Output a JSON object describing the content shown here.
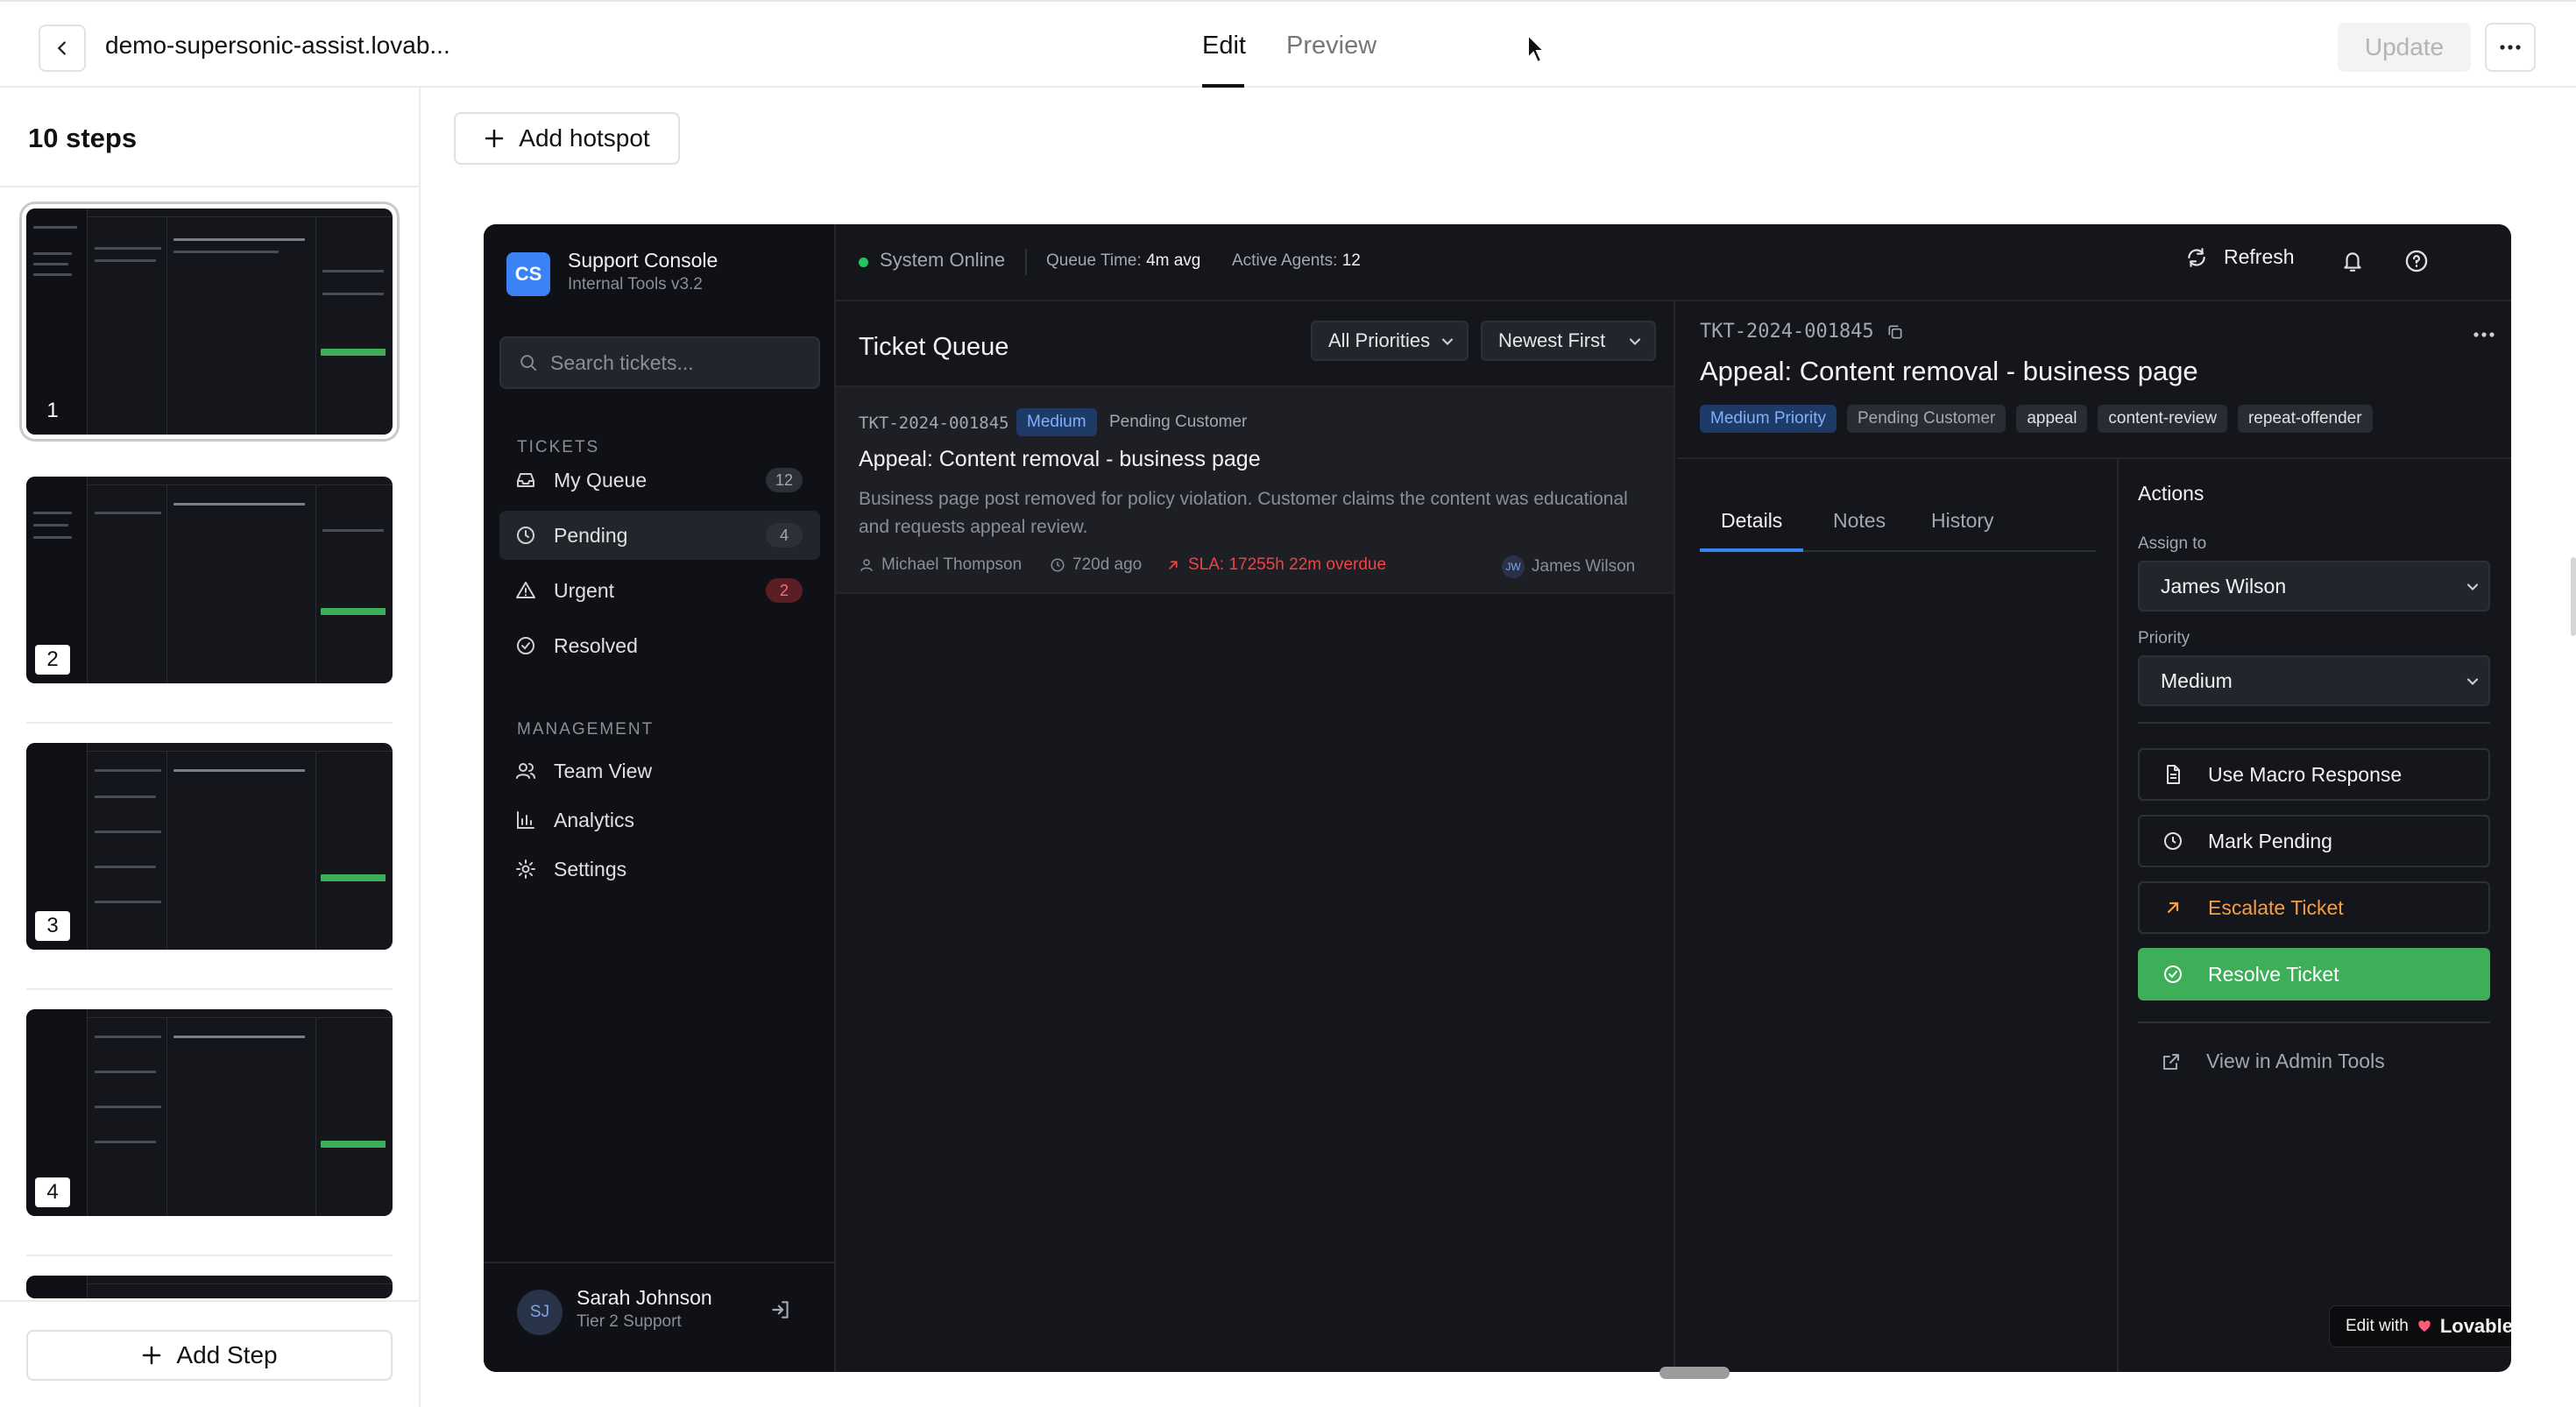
{
  "editor": {
    "project_title": "demo-supersonic-assist.lovab...",
    "tabs": {
      "edit": "Edit",
      "preview": "Preview"
    },
    "update_label": "Update",
    "steps_count_label": "10 steps",
    "step_numbers": [
      "1",
      "2",
      "3",
      "4"
    ],
    "add_step_label": "Add Step",
    "add_hotspot_label": "Add hotspot"
  },
  "app": {
    "brand": {
      "logo": "CS",
      "name": "Support Console",
      "version": "Internal Tools v3.2"
    },
    "search_placeholder": "Search tickets...",
    "sections": {
      "tickets": "TICKETS",
      "management": "MANAGEMENT"
    },
    "nav_tickets": [
      {
        "label": "My Queue",
        "count": "12",
        "icon": "inbox-icon"
      },
      {
        "label": "Pending",
        "count": "4",
        "icon": "clock-icon"
      },
      {
        "label": "Urgent",
        "count": "2",
        "icon": "warning-icon"
      },
      {
        "label": "Resolved",
        "count": "",
        "icon": "check-circle-icon"
      }
    ],
    "nav_management": [
      {
        "label": "Team View",
        "icon": "users-icon"
      },
      {
        "label": "Analytics",
        "icon": "bar-chart-icon"
      },
      {
        "label": "Settings",
        "icon": "gear-icon"
      }
    ],
    "user": {
      "initials": "SJ",
      "name": "Sarah Johnson",
      "role": "Tier 2 Support"
    },
    "header": {
      "status": "System Online",
      "queue_time_label": "Queue Time:",
      "queue_time_value": "4m avg",
      "active_agents_label": "Active Agents:",
      "active_agents_value": "12",
      "refresh_label": "Refresh"
    },
    "queue": {
      "title": "Ticket Queue",
      "priority_filter": "All Priorities",
      "sort": "Newest First",
      "ticket": {
        "id": "TKT-2024-001845",
        "priority": "Medium",
        "status": "Pending Customer",
        "title": "Appeal: Content removal - business page",
        "description": "Business page post removed for policy violation. Customer claims the content was educational and requests appeal review.",
        "customer": "Michael Thompson",
        "age": "720d ago",
        "sla": "SLA: 17255h 22m overdue",
        "assignee_initials": "JW",
        "assignee": "James Wilson"
      }
    },
    "detail": {
      "id": "TKT-2024-001845",
      "title": "Appeal: Content removal - business page",
      "tags": [
        "Medium Priority",
        "Pending Customer",
        "appeal",
        "content-review",
        "repeat-offender"
      ],
      "tabs": [
        "Details",
        "Notes",
        "History"
      ],
      "actions": {
        "title": "Actions",
        "assign_label": "Assign to",
        "assign_value": "James Wilson",
        "priority_label": "Priority",
        "priority_value": "Medium",
        "macro": "Use Macro Response",
        "pending": "Mark Pending",
        "escalate": "Escalate Ticket",
        "resolve": "Resolve Ticket",
        "admin": "View in Admin Tools"
      }
    },
    "badge": {
      "prefix": "Edit with",
      "brand": "Lovable",
      "close": "×"
    }
  },
  "colors": {
    "accent_blue": "#3b82f6",
    "success_green": "#3fae59",
    "danger_red": "#ef4444",
    "warning_orange": "#f59e42",
    "app_bg": "#15161b"
  }
}
